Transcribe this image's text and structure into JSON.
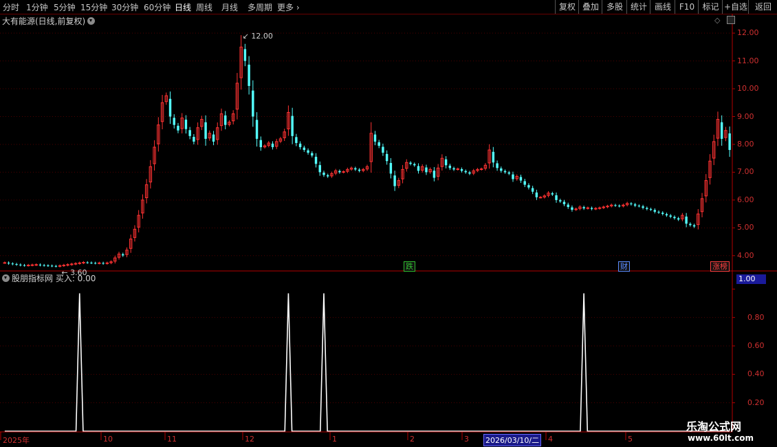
{
  "toolbar": {
    "periods": [
      "分时",
      "1分钟",
      "5分钟",
      "15分钟",
      "30分钟",
      "60分钟",
      "日线",
      "周线",
      "月线",
      "多周期",
      "更多"
    ],
    "active": "日线",
    "right": [
      "复权",
      "叠加",
      "多股",
      "统计",
      "画线",
      "F10",
      "标记",
      "+自选",
      "返回"
    ]
  },
  "stock": {
    "title": "大有能源(日线,前复权)",
    "high_label": "12.00",
    "low_label": "3.60"
  },
  "indicator": {
    "title": "股朋指标网  买入: 0.00",
    "current_value": "1.00"
  },
  "badges": [
    {
      "text": "跌",
      "color": "#30c030"
    },
    {
      "text": "财",
      "color": "#5a8cff"
    },
    {
      "text": "涨榜",
      "color": "#ff4040"
    }
  ],
  "x_selected": "2026/03/10/二",
  "watermark": {
    "line1": "乐淘公式网",
    "line2": "www.60lt.com"
  },
  "colors": {
    "up": "#ff3232",
    "down": "#54ffff",
    "axis": "#b40000",
    "grid": "#500000"
  },
  "chart_data": [
    {
      "type": "candlestick",
      "ylim": [
        3.5,
        12.3
      ],
      "yticks": [
        4.0,
        5.0,
        6.0,
        7.0,
        8.0,
        9.0,
        10.0,
        11.0,
        12.0
      ],
      "x_tick_labels": [
        "2025年",
        "10",
        "11",
        "12",
        "1",
        "2",
        "3",
        "4",
        "5"
      ],
      "annotations": [
        {
          "text": "12.00",
          "value": 12.0
        },
        {
          "text": "3.60",
          "value": 3.6
        }
      ],
      "closes": [
        3.75,
        3.72,
        3.7,
        3.68,
        3.66,
        3.65,
        3.66,
        3.67,
        3.68,
        3.66,
        3.65,
        3.64,
        3.63,
        3.62,
        3.64,
        3.66,
        3.68,
        3.7,
        3.72,
        3.74,
        3.76,
        3.75,
        3.74,
        3.73,
        3.74,
        3.72,
        3.74,
        3.78,
        3.92,
        4.06,
        4.01,
        4.2,
        4.6,
        4.95,
        5.45,
        6.0,
        6.55,
        7.2,
        7.9,
        8.7,
        9.5,
        9.75,
        9.0,
        8.7,
        8.5,
        8.95,
        8.55,
        8.3,
        8.1,
        8.6,
        8.9,
        8.2,
        8.4,
        8.1,
        8.6,
        9.1,
        8.7,
        8.8,
        9.1,
        10.2,
        11.5,
        11.0,
        10.1,
        9.0,
        8.2,
        7.9,
        7.95,
        8.05,
        7.9,
        8.1,
        8.2,
        8.45,
        9.15,
        8.3,
        8.05,
        7.9,
        7.8,
        7.7,
        7.6,
        7.3,
        7.0,
        6.9,
        6.85,
        6.95,
        7.05,
        7.0,
        7.02,
        7.1,
        7.15,
        7.1,
        7.05,
        7.1,
        7.2,
        8.4,
        8.1,
        7.95,
        7.7,
        7.4,
        6.95,
        6.5,
        6.7,
        7.1,
        7.35,
        7.3,
        7.25,
        7.05,
        7.2,
        7.0,
        7.1,
        6.8,
        7.15,
        7.5,
        7.25,
        7.15,
        7.1,
        7.12,
        7.05,
        7.0,
        6.95,
        7.05,
        7.1,
        7.12,
        7.25,
        7.8,
        7.35,
        7.15,
        7.05,
        7.0,
        6.95,
        6.75,
        6.85,
        6.7,
        6.55,
        6.45,
        6.3,
        6.1,
        6.1,
        6.15,
        6.25,
        6.2,
        6.0,
        5.95,
        5.85,
        5.75,
        5.65,
        5.68,
        5.75,
        5.7,
        5.72,
        5.68,
        5.7,
        5.72,
        5.75,
        5.78,
        5.82,
        5.8,
        5.78,
        5.82,
        5.88,
        5.85,
        5.8,
        5.78,
        5.72,
        5.68,
        5.65,
        5.58,
        5.55,
        5.5,
        5.45,
        5.4,
        5.35,
        5.3,
        5.45,
        5.15,
        5.1,
        5.05,
        5.5,
        6.05,
        6.7,
        7.4,
        8.1,
        8.9,
        8.2,
        8.5,
        7.8
      ]
    },
    {
      "type": "line",
      "title": "股朋指标网",
      "ylim": [
        0,
        1.05
      ],
      "yticks": [
        0.2,
        0.4,
        0.6,
        0.8,
        1.0
      ],
      "signal_bars": [
        19,
        72,
        81,
        147
      ]
    }
  ]
}
